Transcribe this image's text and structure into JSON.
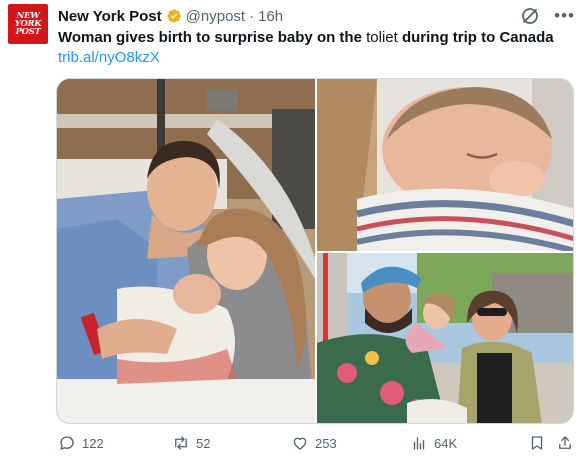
{
  "account": {
    "avatar_lines": [
      "NEW",
      "YORK",
      "POST"
    ],
    "name": "New York Post",
    "handle": "@nypost",
    "separator": "·",
    "time": "16h"
  },
  "tweet": {
    "text_part1": "Woman gives birth to surprise baby on the ",
    "text_part2": "toliet",
    "text_part3": " during trip to Canada",
    "link": "trib.al/nyO8kzX"
  },
  "media": {
    "photos": [
      "hospital-photo",
      "newborn-closeup-photo",
      "family-selfie-photo"
    ]
  },
  "actions": {
    "replies": "122",
    "reposts": "52",
    "likes": "253",
    "views": "64K"
  },
  "colors": {
    "brand_red": "#d3161b",
    "verified_gold": "#e2b719",
    "link_blue": "#1d9bf0",
    "muted": "#536471"
  },
  "icons": [
    "verified-badge-icon",
    "grok-icon",
    "more-icon",
    "reply-icon",
    "repost-icon",
    "like-icon",
    "views-icon",
    "bookmark-icon",
    "share-icon"
  ]
}
